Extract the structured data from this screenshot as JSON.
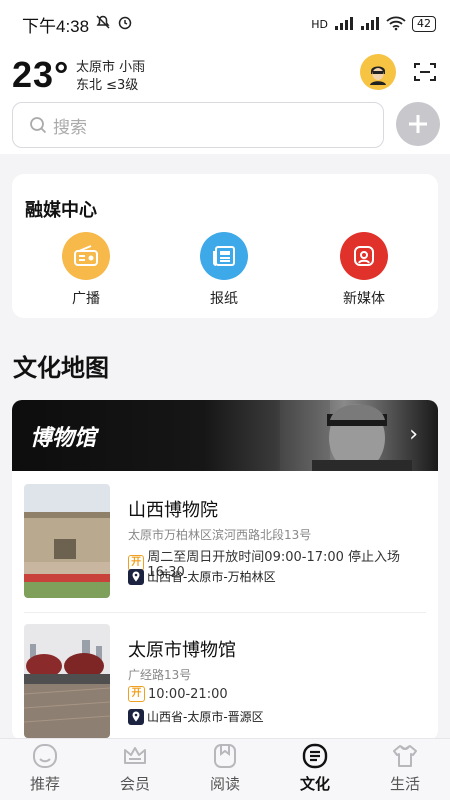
{
  "status_bar": {
    "time": "下午4:38",
    "battery": "42",
    "network_label": "HD"
  },
  "header": {
    "temperature": "23°",
    "city_weather": "太原市 小雨",
    "wind": "东北 ≤3级",
    "search_placeholder": "搜索"
  },
  "media_center": {
    "title": "融媒中心",
    "items": [
      {
        "label": "广播",
        "icon": "radio-icon",
        "color": "#f6b94a"
      },
      {
        "label": "报纸",
        "icon": "newspaper-icon",
        "color": "#3ea9e8"
      },
      {
        "label": "新媒体",
        "icon": "new-media-icon",
        "color": "#e0322b"
      }
    ]
  },
  "culture_map": {
    "title": "文化地图",
    "banner_title": "博物馆",
    "museums": [
      {
        "name": "山西博物院",
        "address": "太原市万柏林区滨河西路北段13号",
        "open_badge": "开",
        "hours": "周二至周日开放时间09:00-17:00 停止入场16:30",
        "region": "山西省-太原市-万柏林区"
      },
      {
        "name": "太原市博物馆",
        "address": "广经路13号",
        "open_badge": "开",
        "hours": "10:00-21:00",
        "region": "山西省-太原市-晋源区"
      }
    ]
  },
  "tabbar": {
    "tabs": [
      {
        "label": "推荐",
        "icon": "smile-icon"
      },
      {
        "label": "会员",
        "icon": "crown-icon"
      },
      {
        "label": "阅读",
        "icon": "book-icon"
      },
      {
        "label": "文化",
        "icon": "culture-icon",
        "active": true
      },
      {
        "label": "生活",
        "icon": "shirt-icon"
      }
    ]
  }
}
